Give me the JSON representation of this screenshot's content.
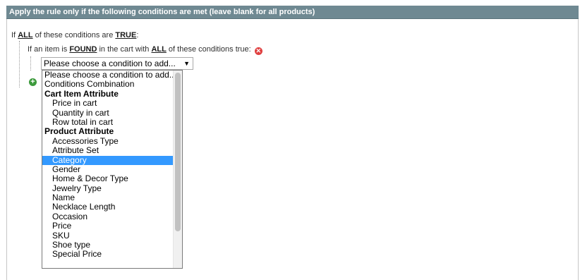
{
  "header": {
    "title": "Apply the rule only if the following conditions are met (leave blank for all products)"
  },
  "condition_root": {
    "prefix": "If",
    "aggregator": "ALL",
    "middle": "of these conditions are",
    "value": "TRUE",
    "suffix": ":"
  },
  "condition_found": {
    "prefix": "If an item is",
    "found": "FOUND",
    "middle": "in the cart with",
    "aggregator": "ALL",
    "suffix": "of these conditions true:",
    "remove_glyph": "✕"
  },
  "add_condition": {
    "glyph": "+"
  },
  "select": {
    "selected_value": "Please choose a condition to add...",
    "arrow": "▼",
    "options": [
      {
        "label": "Please choose a condition to add...",
        "kind": "option",
        "indent": false
      },
      {
        "label": "Conditions Combination",
        "kind": "option",
        "indent": false
      },
      {
        "label": "Cart Item Attribute",
        "kind": "group",
        "indent": false
      },
      {
        "label": "Price in cart",
        "kind": "option",
        "indent": true
      },
      {
        "label": "Quantity in cart",
        "kind": "option",
        "indent": true
      },
      {
        "label": "Row total in cart",
        "kind": "option",
        "indent": true
      },
      {
        "label": "Product Attribute",
        "kind": "group",
        "indent": false
      },
      {
        "label": "Accessories Type",
        "kind": "option",
        "indent": true
      },
      {
        "label": "Attribute Set",
        "kind": "option",
        "indent": true
      },
      {
        "label": "Category",
        "kind": "option",
        "indent": true,
        "selected": true
      },
      {
        "label": "Gender",
        "kind": "option",
        "indent": true
      },
      {
        "label": "Home & Decor Type",
        "kind": "option",
        "indent": true
      },
      {
        "label": "Jewelry Type",
        "kind": "option",
        "indent": true
      },
      {
        "label": "Name",
        "kind": "option",
        "indent": true
      },
      {
        "label": "Necklace Length",
        "kind": "option",
        "indent": true
      },
      {
        "label": "Occasion",
        "kind": "option",
        "indent": true
      },
      {
        "label": "Price",
        "kind": "option",
        "indent": true
      },
      {
        "label": "SKU",
        "kind": "option",
        "indent": true
      },
      {
        "label": "Shoe type",
        "kind": "option",
        "indent": true
      },
      {
        "label": "Special Price",
        "kind": "option",
        "indent": true
      }
    ]
  },
  "colors": {
    "header_bg": "#6f8992",
    "selected_bg": "#3399ff",
    "remove": "#e04040",
    "add": "#3c9a3c"
  }
}
